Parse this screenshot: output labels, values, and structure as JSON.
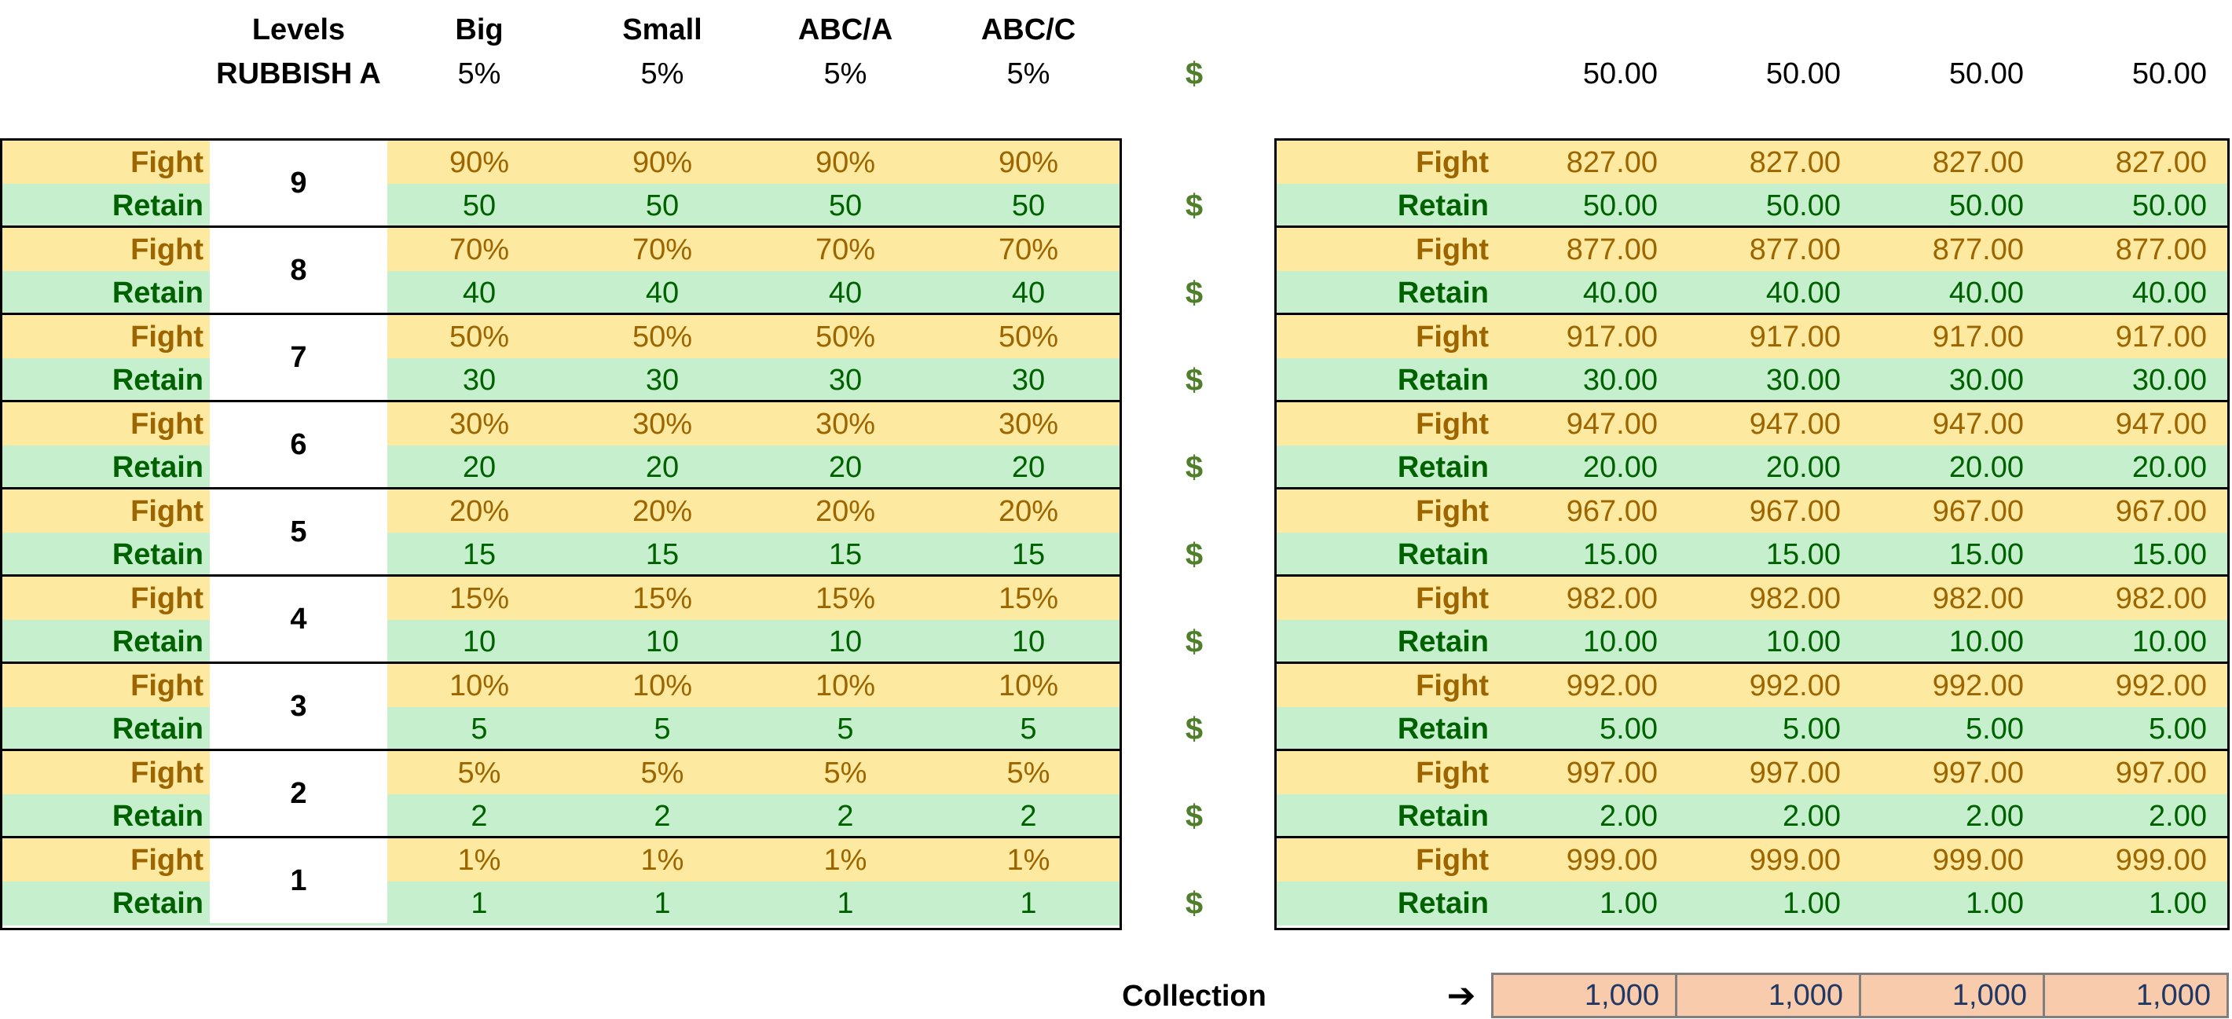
{
  "header": {
    "levels_label": "Levels",
    "rubbish_label": "RUBBISH A",
    "columns": [
      "Big",
      "Small",
      "ABC/A",
      "ABC/C"
    ],
    "rubbish_pcts": [
      "5%",
      "5%",
      "5%",
      "5%"
    ],
    "dollar": "$",
    "right_values": [
      "50.00",
      "50.00",
      "50.00",
      "50.00"
    ]
  },
  "labels": {
    "fight": "Fight",
    "retain": "Retain"
  },
  "levels": [
    {
      "level": "9",
      "fight": [
        "90%",
        "90%",
        "90%",
        "90%"
      ],
      "retain": [
        "50",
        "50",
        "50",
        "50"
      ],
      "right_fight": [
        "827.00",
        "827.00",
        "827.00",
        "827.00"
      ],
      "right_retain": [
        "50.00",
        "50.00",
        "50.00",
        "50.00"
      ]
    },
    {
      "level": "8",
      "fight": [
        "70%",
        "70%",
        "70%",
        "70%"
      ],
      "retain": [
        "40",
        "40",
        "40",
        "40"
      ],
      "right_fight": [
        "877.00",
        "877.00",
        "877.00",
        "877.00"
      ],
      "right_retain": [
        "40.00",
        "40.00",
        "40.00",
        "40.00"
      ]
    },
    {
      "level": "7",
      "fight": [
        "50%",
        "50%",
        "50%",
        "50%"
      ],
      "retain": [
        "30",
        "30",
        "30",
        "30"
      ],
      "right_fight": [
        "917.00",
        "917.00",
        "917.00",
        "917.00"
      ],
      "right_retain": [
        "30.00",
        "30.00",
        "30.00",
        "30.00"
      ]
    },
    {
      "level": "6",
      "fight": [
        "30%",
        "30%",
        "30%",
        "30%"
      ],
      "retain": [
        "20",
        "20",
        "20",
        "20"
      ],
      "right_fight": [
        "947.00",
        "947.00",
        "947.00",
        "947.00"
      ],
      "right_retain": [
        "20.00",
        "20.00",
        "20.00",
        "20.00"
      ]
    },
    {
      "level": "5",
      "fight": [
        "20%",
        "20%",
        "20%",
        "20%"
      ],
      "retain": [
        "15",
        "15",
        "15",
        "15"
      ],
      "right_fight": [
        "967.00",
        "967.00",
        "967.00",
        "967.00"
      ],
      "right_retain": [
        "15.00",
        "15.00",
        "15.00",
        "15.00"
      ]
    },
    {
      "level": "4",
      "fight": [
        "15%",
        "15%",
        "15%",
        "15%"
      ],
      "retain": [
        "10",
        "10",
        "10",
        "10"
      ],
      "right_fight": [
        "982.00",
        "982.00",
        "982.00",
        "982.00"
      ],
      "right_retain": [
        "10.00",
        "10.00",
        "10.00",
        "10.00"
      ]
    },
    {
      "level": "3",
      "fight": [
        "10%",
        "10%",
        "10%",
        "10%"
      ],
      "retain": [
        "5",
        "5",
        "5",
        "5"
      ],
      "right_fight": [
        "992.00",
        "992.00",
        "992.00",
        "992.00"
      ],
      "right_retain": [
        "5.00",
        "5.00",
        "5.00",
        "5.00"
      ]
    },
    {
      "level": "2",
      "fight": [
        "5%",
        "5%",
        "5%",
        "5%"
      ],
      "retain": [
        "2",
        "2",
        "2",
        "2"
      ],
      "right_fight": [
        "997.00",
        "997.00",
        "997.00",
        "997.00"
      ],
      "right_retain": [
        "2.00",
        "2.00",
        "2.00",
        "2.00"
      ]
    },
    {
      "level": "1",
      "fight": [
        "1%",
        "1%",
        "1%",
        "1%"
      ],
      "retain": [
        "1",
        "1",
        "1",
        "1"
      ],
      "right_fight": [
        "999.00",
        "999.00",
        "999.00",
        "999.00"
      ],
      "right_retain": [
        "1.00",
        "1.00",
        "1.00",
        "1.00"
      ]
    }
  ],
  "collection": {
    "label": "Collection",
    "arrow": "➔",
    "values": [
      "1,000",
      "1,000",
      "1,000",
      "1,000"
    ]
  },
  "colors": {
    "fight_bg": "#fde9a0",
    "fight_text": "#9c6500",
    "retain_bg": "#c6efce",
    "retain_text": "#006100",
    "collection_bg": "#f8cbad",
    "collection_text": "#1f3864",
    "dollar": "#4f7f2a"
  }
}
